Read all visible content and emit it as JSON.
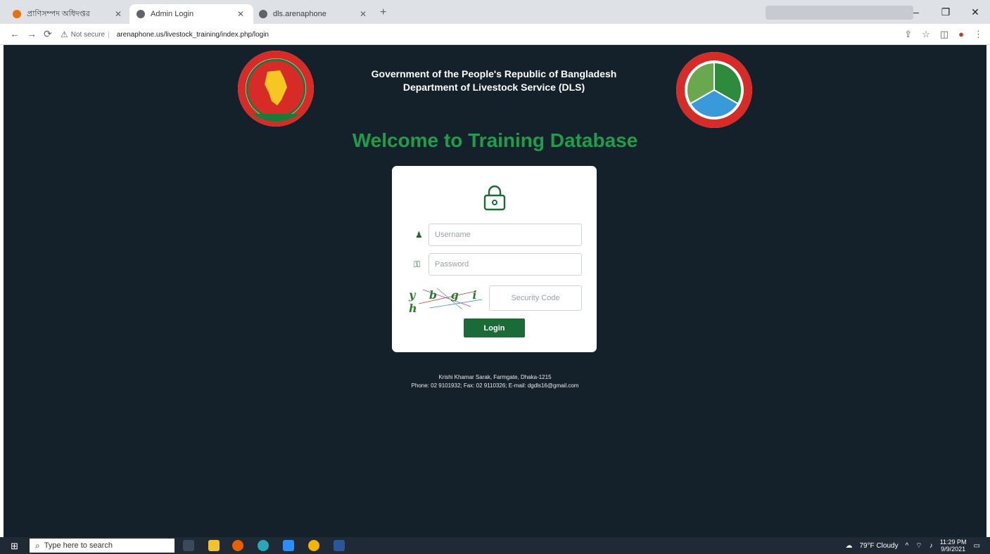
{
  "browser": {
    "tabs": [
      {
        "label": "প্রাণিসম্পদ অধিদপ্তর",
        "active": false
      },
      {
        "label": "Admin Login",
        "active": true
      },
      {
        "label": "dls.arenaphone",
        "active": false
      }
    ],
    "new_tab_symbol": "+",
    "window_controls": [
      "–",
      "❐",
      "✕"
    ],
    "security_label": "Not secure",
    "url": "arenaphone.us/livestock_training/index.php/login"
  },
  "header": {
    "line1": "Government of the People's Republic of Bangladesh",
    "line2": "Department of Livestock Service (DLS)",
    "welcome": "Welcome to Training Database"
  },
  "login": {
    "username_placeholder": "Username",
    "password_placeholder": "Password",
    "captcha_text": "y b g i h",
    "security_placeholder": "Security Code",
    "login_button": "Login"
  },
  "footer": {
    "address": "Krishi Khamar Sarak, Farmgate, Dhaka-1215",
    "contact": "Phone: 02 9101932; Fax: 02 9110326; E-mail: dgdls16@gmail.com"
  },
  "taskbar": {
    "search_placeholder": "Type here to search",
    "weather": "79°F  Cloudy",
    "time": "11:29 PM",
    "date": "9/9/2021"
  },
  "colors": {
    "page_bg": "#15212a",
    "accent_green": "#1f9d4b",
    "button_green": "#1a6b37"
  }
}
